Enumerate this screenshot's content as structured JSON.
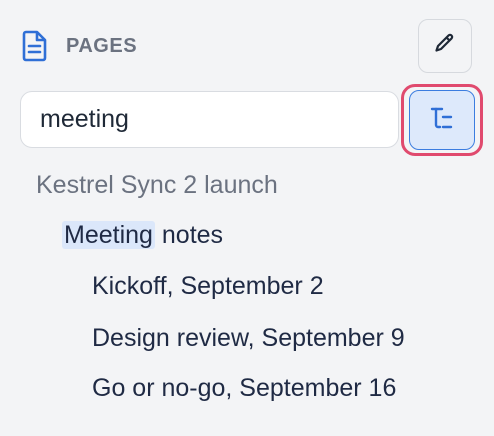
{
  "sidebar": {
    "section_icon": "document-icon",
    "section_title": "PAGES",
    "edit_icon": "pencil-icon",
    "search": {
      "value": "meeting"
    },
    "tree_toggle_icon": "tree-view-icon",
    "results": {
      "parent": "Kestrel Sync 2 launch",
      "match": {
        "highlight": "Meeting",
        "rest": " notes"
      },
      "children": [
        "Kickoff, September 2",
        "Design review, September 9",
        "Go or no-go, September 16"
      ]
    }
  },
  "colors": {
    "background": "#f3f4f6",
    "accent": "#2f6fd6",
    "focus_ring": "#e04a6e",
    "highlight": "#dbe7fa",
    "muted_text": "#6b7280",
    "primary_text": "#1f2a44"
  }
}
